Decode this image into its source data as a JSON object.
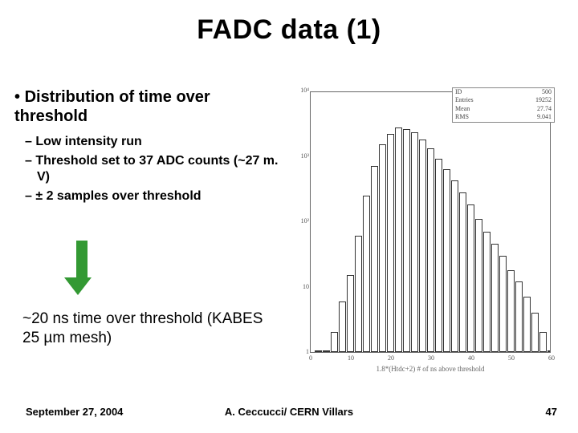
{
  "title": "FADC data (1)",
  "bullet_main": "Distribution of time over threshold",
  "subs": [
    "Low intensity run",
    "Threshold set to 37 ADC counts (~27 m. V)",
    "± 2 samples over threshold"
  ],
  "conclusion": "~20 ns time over threshold (KABES 25 µm mesh)",
  "footer": {
    "left": "September 27, 2004",
    "center": "A. Ceccucci/ CERN    Villars",
    "right": "47"
  },
  "chart_data": {
    "type": "bar",
    "title": "",
    "xlabel": "1.8*(Htdc+2)  # of ns above threshold",
    "ylabel": "",
    "yscale": "log",
    "ylim": [
      1,
      10000
    ],
    "xlim": [
      0,
      60
    ],
    "xticks": [
      0,
      10,
      20,
      30,
      40,
      50,
      60
    ],
    "yticks": [
      1,
      10,
      100,
      1000,
      10000
    ],
    "ytick_labels": [
      "1",
      "10",
      "10²",
      "10³",
      "10⁴"
    ],
    "stats": {
      "ID": "500",
      "Entries": "19252",
      "Mean": "27.74",
      "RMS": "9.041"
    },
    "bins": [
      {
        "x": 2,
        "count": 1
      },
      {
        "x": 4,
        "count": 1
      },
      {
        "x": 6,
        "count": 2
      },
      {
        "x": 8,
        "count": 6
      },
      {
        "x": 10,
        "count": 15
      },
      {
        "x": 12,
        "count": 60
      },
      {
        "x": 14,
        "count": 250
      },
      {
        "x": 16,
        "count": 700
      },
      {
        "x": 18,
        "count": 1500
      },
      {
        "x": 20,
        "count": 2200
      },
      {
        "x": 22,
        "count": 2700
      },
      {
        "x": 24,
        "count": 2600
      },
      {
        "x": 26,
        "count": 2300
      },
      {
        "x": 28,
        "count": 1800
      },
      {
        "x": 30,
        "count": 1300
      },
      {
        "x": 32,
        "count": 900
      },
      {
        "x": 34,
        "count": 620
      },
      {
        "x": 36,
        "count": 420
      },
      {
        "x": 38,
        "count": 280
      },
      {
        "x": 40,
        "count": 180
      },
      {
        "x": 42,
        "count": 110
      },
      {
        "x": 44,
        "count": 70
      },
      {
        "x": 46,
        "count": 45
      },
      {
        "x": 48,
        "count": 30
      },
      {
        "x": 50,
        "count": 18
      },
      {
        "x": 52,
        "count": 12
      },
      {
        "x": 54,
        "count": 7
      },
      {
        "x": 56,
        "count": 4
      },
      {
        "x": 58,
        "count": 2
      },
      {
        "x": 60,
        "count": 1
      }
    ]
  }
}
